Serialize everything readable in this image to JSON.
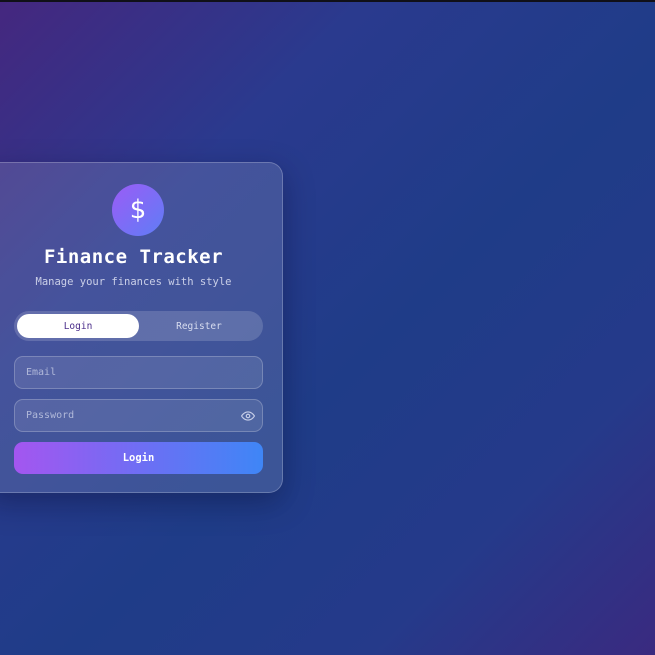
{
  "app": {
    "title": "Finance Tracker",
    "subtitle": "Manage your finances with style",
    "logo_icon": "dollar-icon",
    "logo_glyph": "$"
  },
  "tabs": [
    {
      "label": "Login",
      "active": true
    },
    {
      "label": "Register",
      "active": false
    }
  ],
  "form": {
    "email": {
      "value": "",
      "placeholder": "Email"
    },
    "password": {
      "value": "",
      "placeholder": "Password",
      "toggle_icon": "eye-icon"
    },
    "submit_label": "Login"
  },
  "colors": {
    "accent_start": "#a456f0",
    "accent_end": "#3f86f6",
    "active_tab_text": "#4a2d8a"
  }
}
